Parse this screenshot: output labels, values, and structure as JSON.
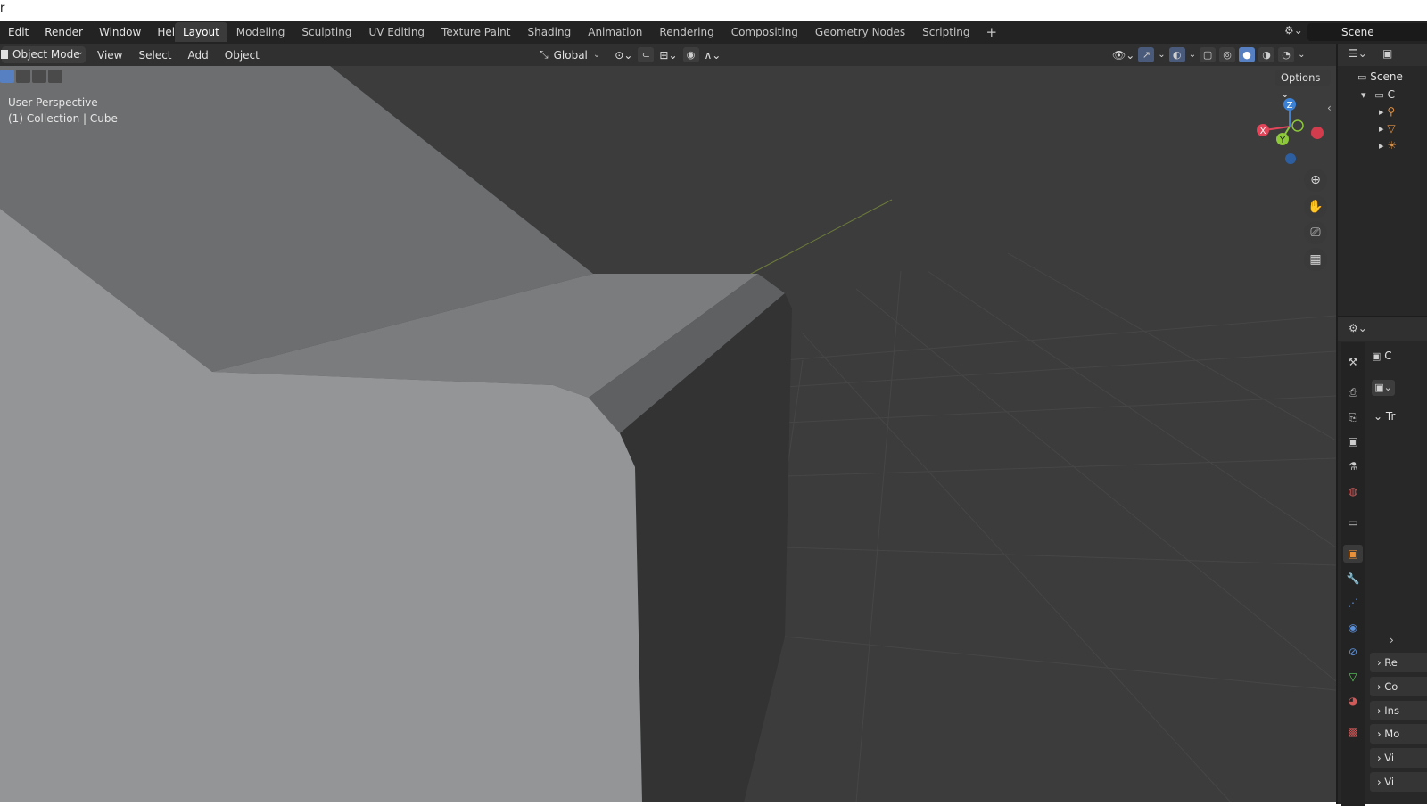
{
  "window": {
    "title_fragment": "r"
  },
  "menu": [
    "Edit",
    "Render",
    "Window",
    "Help"
  ],
  "workspace_tabs": [
    "Layout",
    "Modeling",
    "Sculpting",
    "UV Editing",
    "Texture Paint",
    "Shading",
    "Animation",
    "Rendering",
    "Compositing",
    "Geometry Nodes",
    "Scripting"
  ],
  "active_tab": "Layout",
  "add_tab": "+",
  "scene": {
    "label": "Scene"
  },
  "header": {
    "mode": "Object Mode",
    "menus": [
      "View",
      "Select",
      "Add",
      "Object"
    ],
    "orientation": "Global"
  },
  "viewport": {
    "perspective": "User Perspective",
    "collection": "(1) Collection | Cube",
    "options_label": "Options",
    "gizmo": {
      "x": "X",
      "y": "Y",
      "z": "Z"
    },
    "nav_icons": [
      "zoom-icon",
      "pan-hand-icon",
      "camera-icon",
      "grid-ortho-icon"
    ]
  },
  "outliner": {
    "scene_label": "Scene",
    "collection_label": "C"
  },
  "properties": {
    "object_label": "C",
    "panels": [
      "Tr",
      "Re",
      "Co",
      "Ins",
      "Mo",
      "Vi",
      "Vi"
    ]
  },
  "colors": {
    "topbar": "#232323",
    "viewport_bg": "#3c3c3c",
    "active_tab": "#3b3b3b",
    "accent_blue": "#5680c2",
    "axis_x": "#e0455a",
    "axis_y": "#8cc83a",
    "axis_z": "#3b82d6"
  }
}
